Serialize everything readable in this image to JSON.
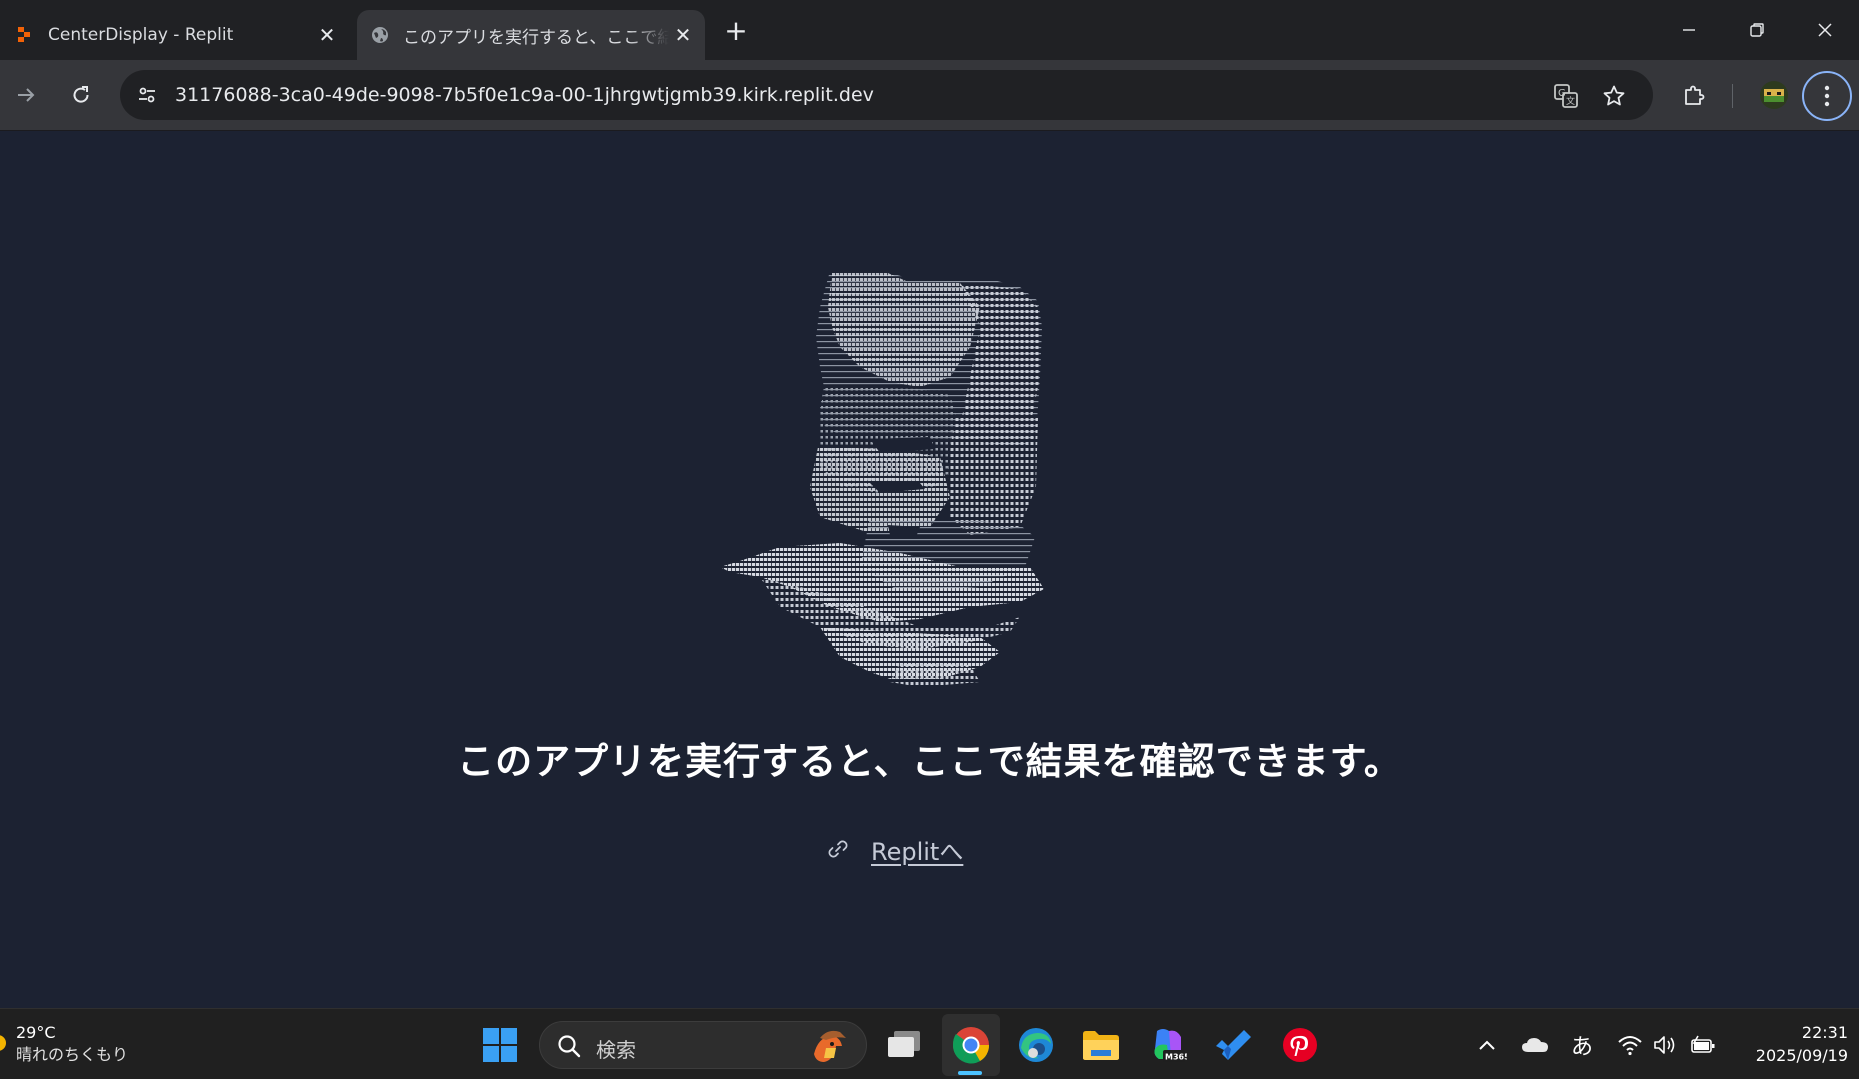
{
  "tabs": [
    {
      "title": "CenterDisplay - Replit",
      "favicon": "replit-icon",
      "active": false
    },
    {
      "title": "このアプリを実行すると、ここで結果を",
      "favicon": "globe-icon",
      "active": true
    }
  ],
  "toolbar": {
    "url": "31176088-3ca0-49de-9098-7b5f0e1c9a-00-1jhrgwtjgmb39.kirk.replit.dev"
  },
  "content": {
    "message": "このアプリを実行すると、ここで結果を確認できます。",
    "link_label": "Replitへ"
  },
  "taskbar": {
    "weather_temp": "29°C",
    "weather_desc": "晴れのちくもり",
    "search_placeholder": "検索",
    "ime_label": "あ",
    "time": "22:31",
    "date": "2025/09/19"
  },
  "colors": {
    "page_background": "#1c2232",
    "tabstrip": "#202124",
    "toolbar": "#35363a",
    "accent_focus": "#8ab4f8",
    "taskbar": "#202020"
  }
}
